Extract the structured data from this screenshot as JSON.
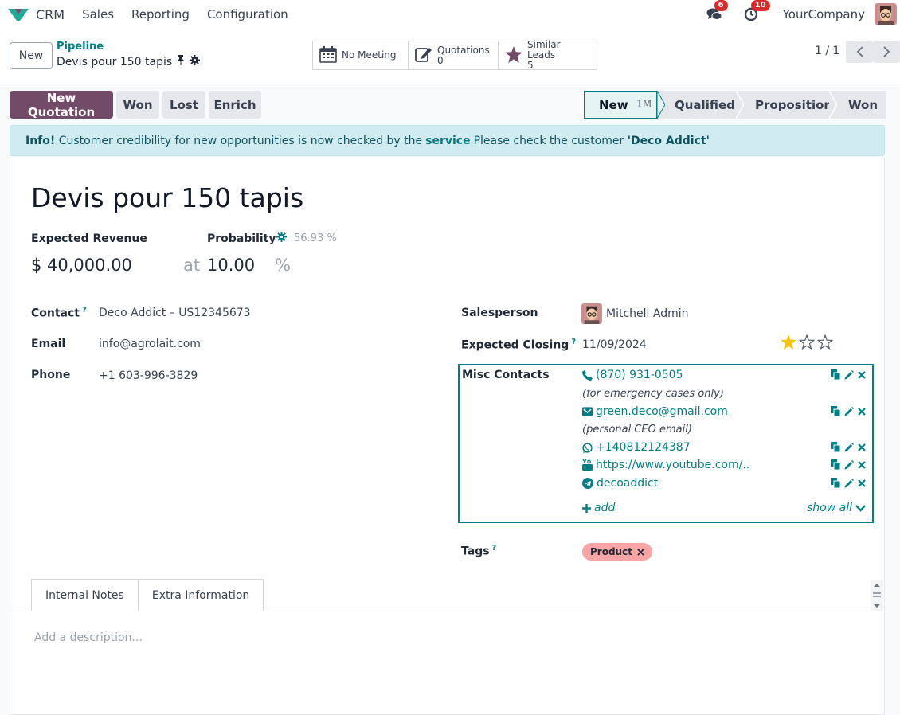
{
  "nav": {
    "app": "CRM",
    "menu": [
      "Sales",
      "Reporting",
      "Configuration"
    ],
    "messages_badge": "6",
    "activities_badge": "10",
    "company": "YourCompany"
  },
  "control": {
    "new_label": "New",
    "breadcrumb_parent": "Pipeline",
    "breadcrumb_current": "Devis pour 150 tapis",
    "smart": [
      {
        "label": "No Meeting",
        "value": ""
      },
      {
        "label": "Quotations",
        "value": "0"
      },
      {
        "label": "Similar Leads",
        "value": "5"
      }
    ],
    "pager": "1 / 1"
  },
  "actions": {
    "new_quotation": "New Quotation",
    "won": "Won",
    "lost": "Lost",
    "enrich": "Enrich"
  },
  "stages": [
    {
      "label": "New",
      "badge": "1M"
    },
    {
      "label": "Qualified"
    },
    {
      "label": "Proposition"
    },
    {
      "label": "Won"
    }
  ],
  "alert": {
    "strong": "Info!",
    "text1": "Customer credibility for new opportunities is now checked by the",
    "link": "service",
    "text2": "Please check the customer",
    "customer": "'Deco Addict'"
  },
  "lead": {
    "title": "Devis pour 150 tapis",
    "expected_revenue_label": "Expected Revenue",
    "expected_revenue": "$ 40,000.00",
    "at": "at",
    "probability_label": "Probability",
    "probability_auto": "56.93 %",
    "probability": "10.00",
    "percent": "%",
    "contact_label": "Contact",
    "contact_help": "?",
    "contact": "Deco Addict – US12345673",
    "email_label": "Email",
    "email": "info@agrolait.com",
    "phone_label": "Phone",
    "phone": "+1 603-996-3829",
    "salesperson_label": "Salesperson",
    "salesperson": "Mitchell Admin",
    "closing_label": "Expected Closing",
    "closing_help": "?",
    "closing": "11/09/2024",
    "priority_stars": 1,
    "misc_label": "Misc Contacts",
    "misc": {
      "phone": "(870) 931-0505",
      "phone_note": "(for emergency cases only)",
      "email": "green.deco@gmail.com",
      "email_note": "(personal CEO email)",
      "whatsapp": "+140812124387",
      "youtube": "https://www.youtube.com/..",
      "telegram": "decoaddict",
      "add": "add",
      "show_all": "show all"
    },
    "tags_label": "Tags",
    "tags_help": "?",
    "tag": "Product"
  },
  "tabs": {
    "notes": "Internal Notes",
    "extra": "Extra Information",
    "placeholder": "Add a description..."
  }
}
